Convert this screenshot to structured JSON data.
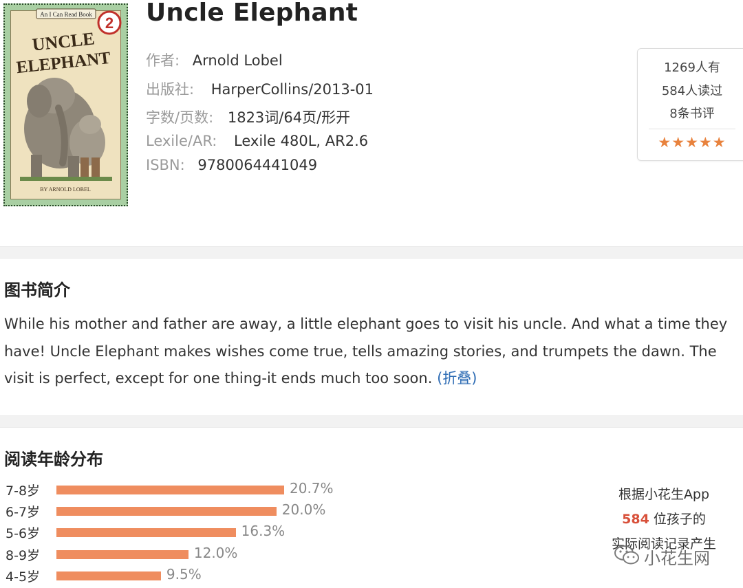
{
  "book": {
    "title": "Uncle Elephant",
    "cover": {
      "series_badge": "An I Can Read Book",
      "level": "2",
      "title_line1": "UNCLE",
      "title_line2": "ELEPHANT",
      "byline": "BY ARNOLD LOBEL"
    },
    "meta": [
      {
        "key": "作者:",
        "value": "Arnold Lobel"
      },
      {
        "key": "出版社:",
        "value": "HarperCollins/2013-01"
      },
      {
        "key": "字数/页数:",
        "value": "1823词/64页/形开"
      },
      {
        "key": "Lexile/AR:",
        "value": "Lexile 480L, AR2.6"
      },
      {
        "key": "ISBN:",
        "value": "9780064441049"
      }
    ]
  },
  "stats": {
    "owners": "1269人有",
    "readers": "584人读过",
    "reviews": "8条书评",
    "stars": "★★★★★",
    "rating": 5,
    "star_color": "#e8823d"
  },
  "intro": {
    "heading": "图书简介",
    "text": "While his mother and father are away, a little elephant goes to visit his uncle. And what a time they have! Uncle Elephant makes wishes come true, tells amazing stories, and trumpets the dawn. The visit is perfect, except for one thing-it ends much too soon.",
    "toggle": "(折叠)"
  },
  "age_distribution": {
    "heading": "阅读年龄分布",
    "bar_color": "#ef8d5f",
    "rows": [
      {
        "label": "7-8岁",
        "percent": 20.7,
        "pct_text": "20.7%"
      },
      {
        "label": "6-7岁",
        "percent": 20.0,
        "pct_text": "20.0%"
      },
      {
        "label": "5-6岁",
        "percent": 16.3,
        "pct_text": "16.3%"
      },
      {
        "label": "8-9岁",
        "percent": 12.0,
        "pct_text": "12.0%"
      },
      {
        "label": "4-5岁",
        "percent": 9.5,
        "pct_text": "9.5%"
      }
    ],
    "note": {
      "line1": "根据小花生App",
      "count": "584",
      "line2_suffix": " 位孩子的",
      "line3": "实际阅读记录产生"
    }
  },
  "watermark": {
    "text": "小花生网",
    "icon": "wechat-icon"
  }
}
